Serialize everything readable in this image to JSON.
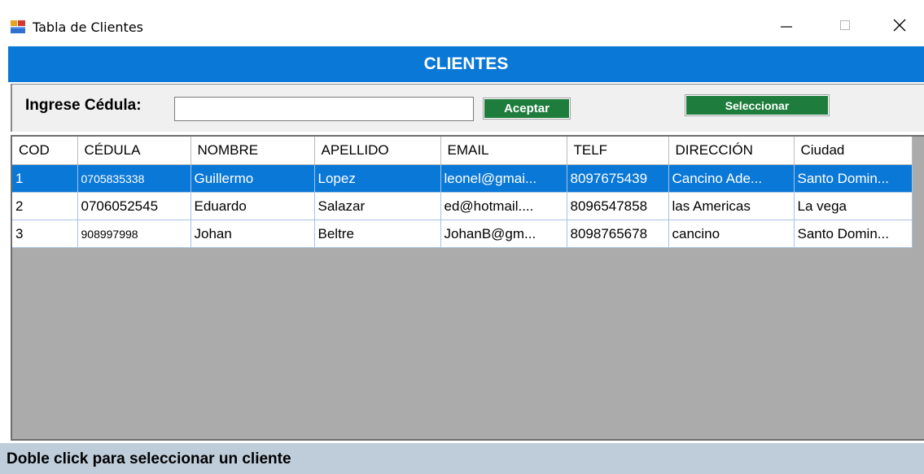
{
  "window": {
    "title": "Tabla de Clientes",
    "icon": "windows-form-icon",
    "controls": {
      "minimize": "minimize-icon",
      "maximize": "maximize-icon",
      "close": "close-icon"
    }
  },
  "header": {
    "title": "CLIENTES",
    "color": "#0a78d7"
  },
  "form": {
    "cedula_label": "Ingrese Cédula:",
    "cedula_value": "",
    "cedula_placeholder": "",
    "accept_label": "Aceptar",
    "select_label": "Seleccionar",
    "button_color": "#1e7d3c"
  },
  "table": {
    "columns": [
      "COD",
      "CÉDULA",
      "NOMBRE",
      "APELLIDO",
      "EMAIL",
      "TELF",
      "DIRECCIÓN",
      "Ciudad"
    ],
    "rows": [
      [
        "1",
        "0705835338",
        "Guillermo",
        "Lopez",
        "leonel@gmai...",
        "8097675439",
        "Cancino Ade...",
        "Santo Domin..."
      ],
      [
        "2",
        "0706052545",
        "Eduardo",
        "Salazar",
        "ed@hotmail....",
        "8096547858",
        "las Americas",
        "La vega"
      ],
      [
        "3",
        "908997998",
        "Johan",
        "Beltre",
        "JohanB@gm...",
        "8098765678",
        "cancino",
        "Santo Domin..."
      ]
    ],
    "selected_row": 0
  },
  "status": {
    "text": "Doble click para seleccionar un cliente",
    "color": "#bfcddb"
  }
}
